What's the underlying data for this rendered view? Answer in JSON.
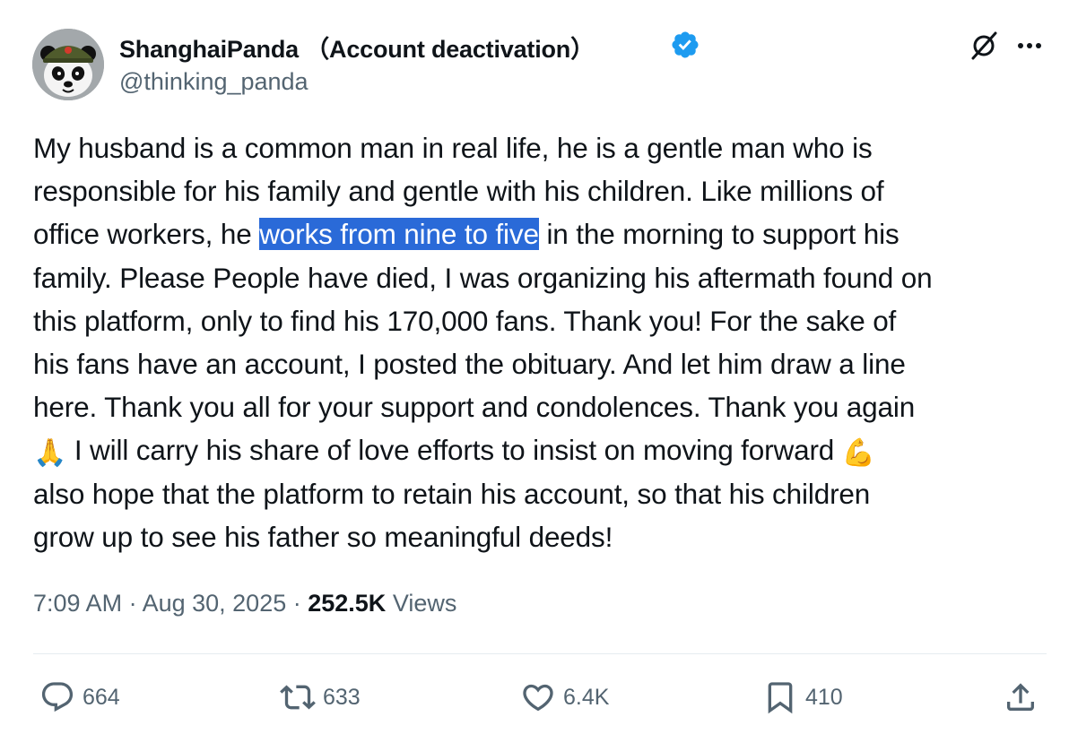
{
  "author": {
    "display_name": "ShanghaiPanda （Account deactivation）",
    "handle": "@thinking_panda",
    "verified": true
  },
  "header_icons": {
    "grok": "grok-icon",
    "more": "more-icon"
  },
  "tweet": {
    "lines": [
      {
        "before": "My husband is a common man in real life, he is a gentle man who is"
      },
      {
        "before": "responsible for his family and gentle with his children. Like millions of"
      },
      {
        "before": "office workers, he ",
        "highlight": "works from nine to five",
        "after": " in the morning to support his"
      },
      {
        "before": "family. Please People have died, I was organizing his aftermath found on"
      },
      {
        "before": "this platform, only to find his 170,000 fans. Thank you! For the sake of"
      },
      {
        "before": "his fans have an account, I posted the obituary. And let him draw a line"
      },
      {
        "before": "here. Thank you all for your support and condolences. Thank you again"
      },
      {
        "emoji_before": "🙏",
        "before": " I will carry his share of love efforts to insist on moving forward ",
        "emoji_after": "💪"
      },
      {
        "before": "also hope that the platform to retain his account, so that his children"
      },
      {
        "before": "grow up to see his father so meaningful deeds!"
      }
    ]
  },
  "meta": {
    "time": "7:09 AM",
    "separator": " · ",
    "date": "Aug 30, 2025",
    "separator2": " · ",
    "views_count": "252.5K",
    "views_label": " Views"
  },
  "actions": {
    "reply_count": "664",
    "repost_count": "633",
    "like_count": "6.4K",
    "bookmark_count": "410"
  },
  "colors": {
    "highlight": "#2a6ad8",
    "verified": "#1d9bf0",
    "secondary_text": "#536471"
  }
}
